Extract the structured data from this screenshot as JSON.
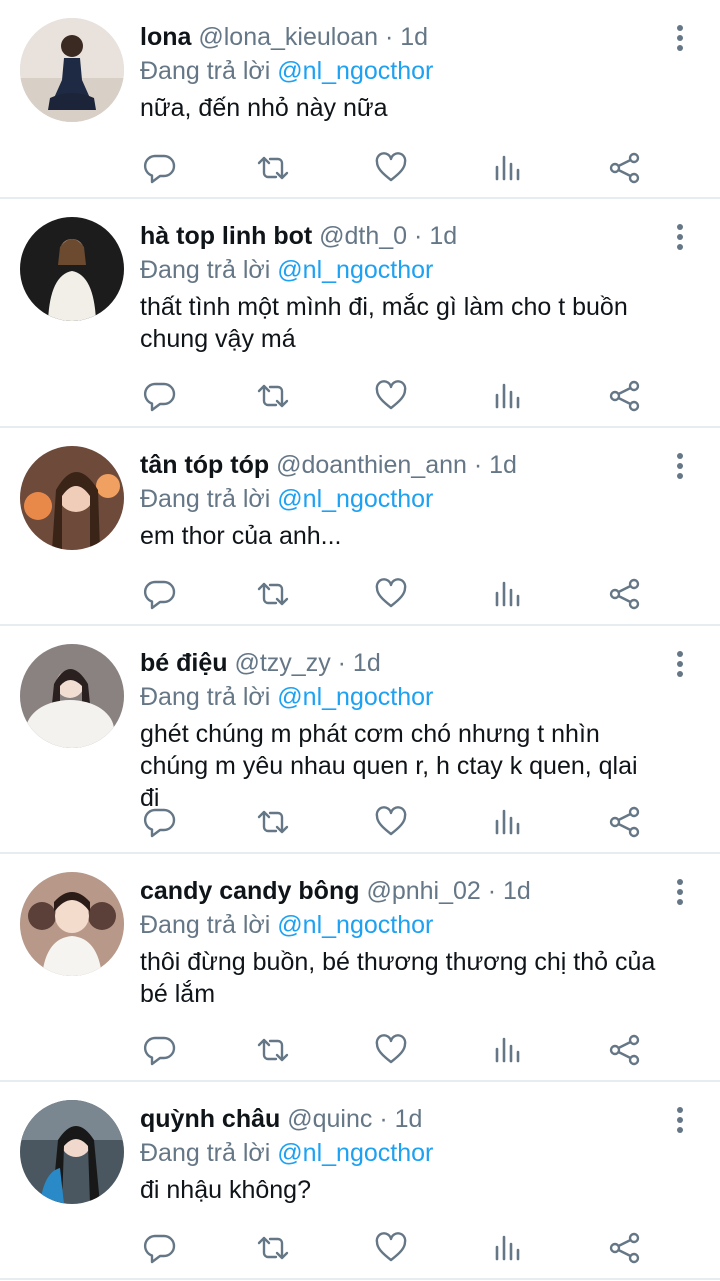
{
  "tweets": [
    {
      "name": "lona",
      "handle": "@lona_kieuloan",
      "time": "1d",
      "reply_prefix": "Đang trả lời",
      "reply_to": "@nl_ngocthor",
      "text": "nữa, đến nhỏ này nữa",
      "avatar_bg": "#e9e2dc"
    },
    {
      "name": "hà top linh bot",
      "handle": "@dth_0",
      "time": "1d",
      "reply_prefix": "Đang trả lời",
      "reply_to": "@nl_ngocthor",
      "text": "thất tình một mình đi, mắc gì làm cho t buồn chung vậy má",
      "avatar_bg": "#1c1c1c"
    },
    {
      "name": "tân tóp tóp",
      "handle": "@doanthien_ann",
      "time": "1d",
      "reply_prefix": "Đang trả lời",
      "reply_to": "@nl_ngocthor",
      "text": "em thor của anh...",
      "avatar_bg": "#6e4a3a"
    },
    {
      "name": "bé điệu",
      "handle": "@tzy_zy",
      "time": "1d",
      "reply_prefix": "Đang trả lời",
      "reply_to": "@nl_ngocthor",
      "text": "ghét chúng m phát cơm chó nhưng t nhìn chúng m yêu nhau quen r, h ctay k quen, qlai đi",
      "avatar_bg": "#8a8280"
    },
    {
      "name": "candy candy bông",
      "handle": "@pnhi_02",
      "time": "1d",
      "reply_prefix": "Đang trả lời",
      "reply_to": "@nl_ngocthor",
      "text": "thôi đừng buồn, bé thương thương chị thỏ của bé lắm",
      "avatar_bg": "#b89888"
    },
    {
      "name": "quỳnh châu",
      "handle": "@quinc",
      "time": "1d",
      "reply_prefix": "Đang trả lời",
      "reply_to": "@nl_ngocthor",
      "text": "đi nhậu không?",
      "avatar_bg": "#4a5660"
    }
  ],
  "colors": {
    "accent": "#1da1f2",
    "muted": "#657786",
    "icon": "#657786",
    "divider": "#e6ecf0"
  },
  "icons": [
    "reply-icon",
    "retweet-icon",
    "like-icon",
    "analytics-icon",
    "share-icon",
    "more-icon"
  ]
}
